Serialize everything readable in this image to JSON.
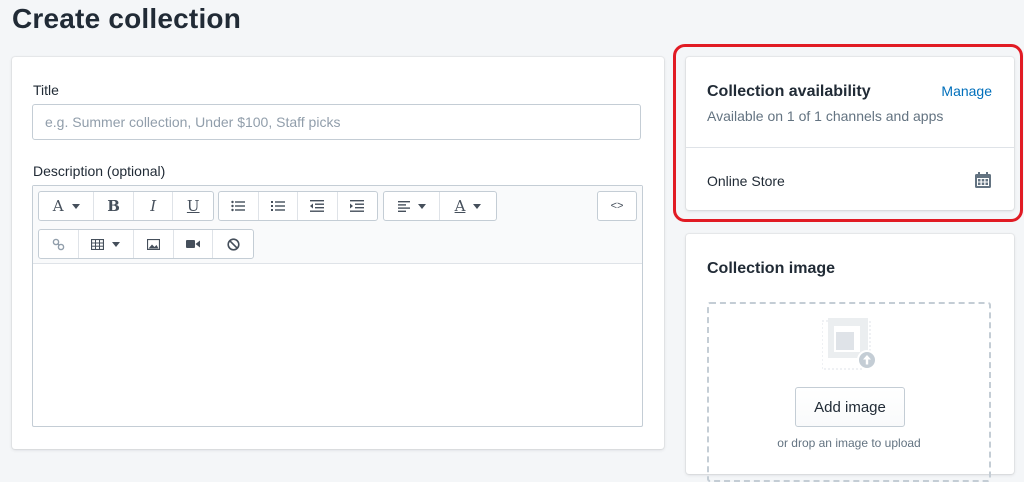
{
  "page": {
    "title": "Create collection"
  },
  "form": {
    "title_label": "Title",
    "title_placeholder": "e.g. Summer collection, Under $100, Staff picks",
    "title_value": "",
    "description_label": "Description (optional)"
  },
  "toolbar": {
    "font_letter": "A",
    "bold": "B",
    "italic": "I",
    "underline": "U",
    "color_letter": "A",
    "code": "<>"
  },
  "availability": {
    "title": "Collection availability",
    "manage_label": "Manage",
    "subtitle": "Available on 1 of 1 channels and apps",
    "channel": "Online Store"
  },
  "image": {
    "title": "Collection image",
    "add_button": "Add image",
    "drop_hint": "or drop an image to upload"
  },
  "colors": {
    "link": "#006fbb",
    "highlight": "#e11b24",
    "background": "#f4f6f8"
  },
  "icons": [
    "chevron-down-icon",
    "list-bullet-icon",
    "list-numbered-icon",
    "outdent-icon",
    "indent-icon",
    "align-left-icon",
    "link-icon",
    "table-icon",
    "image-icon",
    "video-icon",
    "clear-format-icon",
    "code-icon",
    "calendar-icon",
    "image-upload-icon"
  ]
}
